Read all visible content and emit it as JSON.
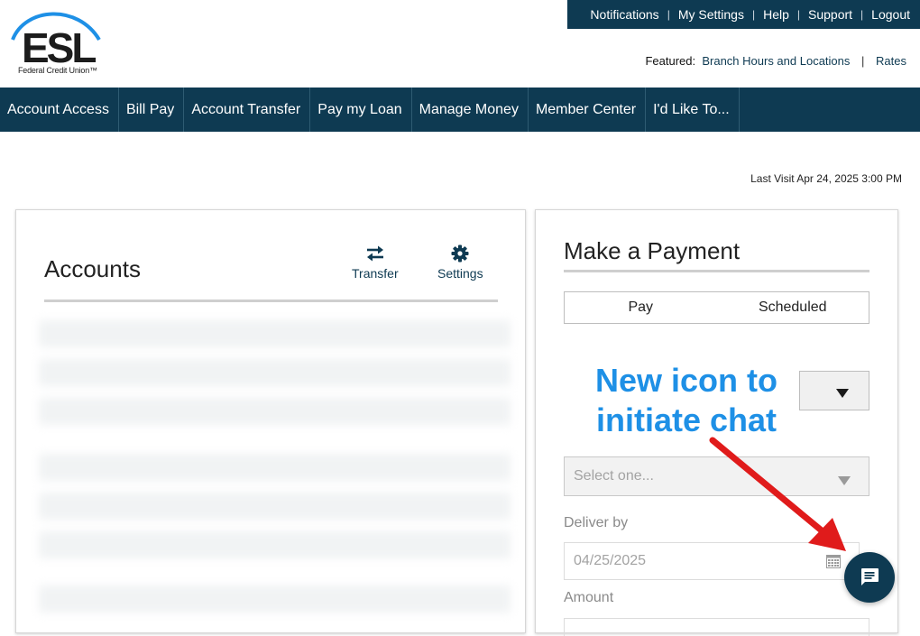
{
  "utility_nav": [
    "Notifications",
    "My Settings",
    "Help",
    "Support",
    "Logout"
  ],
  "logo": {
    "name": "ESL",
    "subtitle": "Federal Credit Union™"
  },
  "featured": {
    "label": "Featured:",
    "links": [
      "Branch Hours and Locations",
      "Rates"
    ]
  },
  "main_nav": [
    "Account Access",
    "Bill Pay",
    "Account Transfer",
    "Pay my Loan",
    "Manage Money",
    "Member Center",
    "I'd Like To..."
  ],
  "last_visit": "Last Visit Apr 24, 2025 3:00 PM",
  "accounts": {
    "title": "Accounts",
    "transfer_label": "Transfer",
    "settings_label": "Settings"
  },
  "payment": {
    "title": "Make a Payment",
    "tabs": [
      "Pay",
      "Scheduled"
    ],
    "select_placeholder": "Select one...",
    "deliver_by_label": "Deliver by",
    "deliver_by_value": "04/25/2025",
    "amount_label": "Amount"
  },
  "annotation": {
    "line1": "New icon to",
    "line2": "initiate chat",
    "color": "#1e90e6",
    "arrow_color": "#e01b1b"
  },
  "colors": {
    "brand_navy": "#0e3a52"
  },
  "icons": {
    "transfer": "transfer-arrows-icon",
    "settings": "gear-icon",
    "dropdown": "caret-down-icon",
    "calendar": "calendar-icon",
    "chat": "chat-bubble-icon"
  }
}
